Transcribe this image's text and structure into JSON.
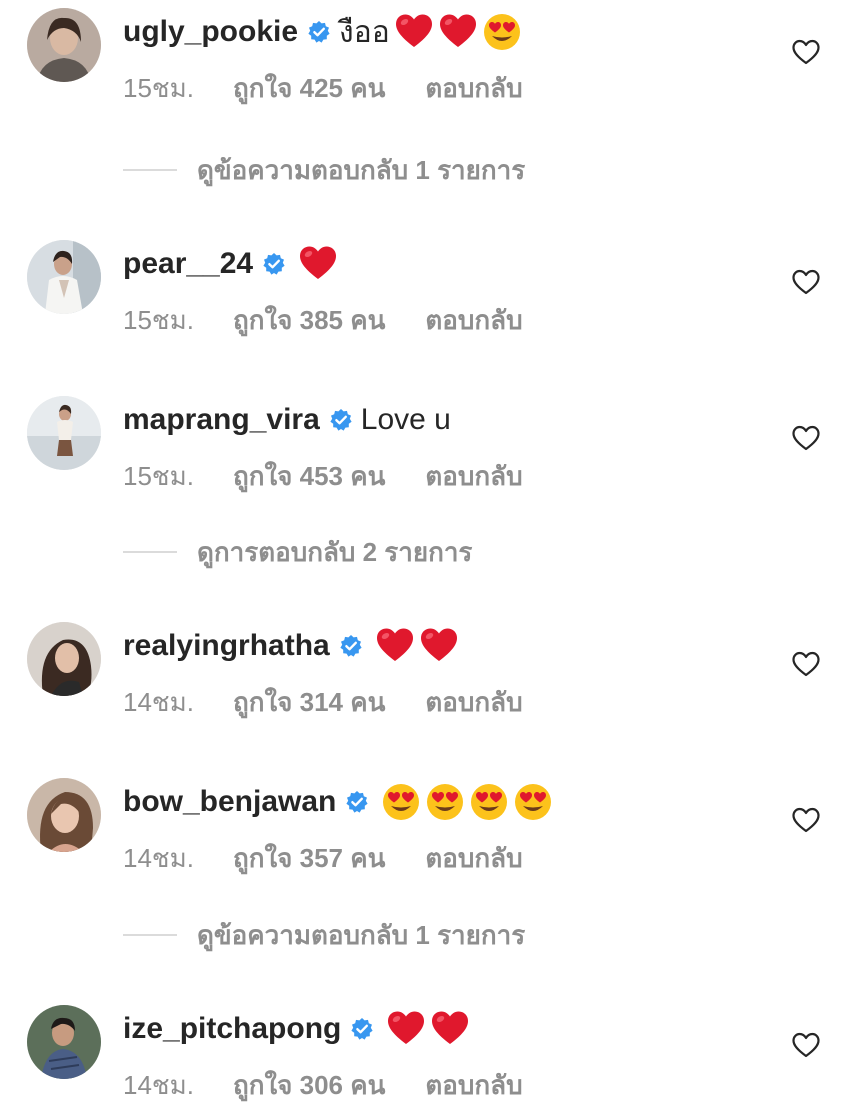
{
  "comments": [
    {
      "username": "ugly_pookie",
      "text": "งืออ",
      "emojis": [
        "red-heart",
        "red-heart",
        "heart-eyes"
      ],
      "time": "15ชม.",
      "likes": "ถูกใจ 425 คน",
      "reply_label": "ตอบกลับ",
      "replies": "ดูข้อความตอบกลับ 1 รายการ"
    },
    {
      "username": "pear__24",
      "text": "",
      "emojis": [
        "red-heart"
      ],
      "time": "15ชม.",
      "likes": "ถูกใจ 385 คน",
      "reply_label": "ตอบกลับ"
    },
    {
      "username": "maprang_vira",
      "text": "Love u",
      "emojis": [],
      "time": "15ชม.",
      "likes": "ถูกใจ 453 คน",
      "reply_label": "ตอบกลับ",
      "replies": "ดูการตอบกลับ 2 รายการ"
    },
    {
      "username": "realyingrhatha",
      "text": "",
      "emojis": [
        "red-heart",
        "red-heart"
      ],
      "time": "14ชม.",
      "likes": "ถูกใจ 314 คน",
      "reply_label": "ตอบกลับ"
    },
    {
      "username": "bow_benjawan",
      "text": "",
      "emojis": [
        "heart-eyes",
        "heart-eyes",
        "heart-eyes",
        "heart-eyes"
      ],
      "time": "14ชม.",
      "likes": "ถูกใจ 357 คน",
      "reply_label": "ตอบกลับ",
      "replies": "ดูข้อความตอบกลับ 1 รายการ"
    },
    {
      "username": "ize_pitchapong",
      "text": "",
      "emojis": [
        "red-heart",
        "red-heart"
      ],
      "time": "14ชม.",
      "likes": "ถูกใจ 306 คน",
      "reply_label": "ตอบกลับ"
    }
  ],
  "icons": {
    "verified": "verified-badge-icon",
    "like": "heart-outline-icon"
  },
  "colors": {
    "text": "#262626",
    "secondary": "#8e8e8e",
    "verified": "#3897f0",
    "divider": "#dbdbdb"
  }
}
